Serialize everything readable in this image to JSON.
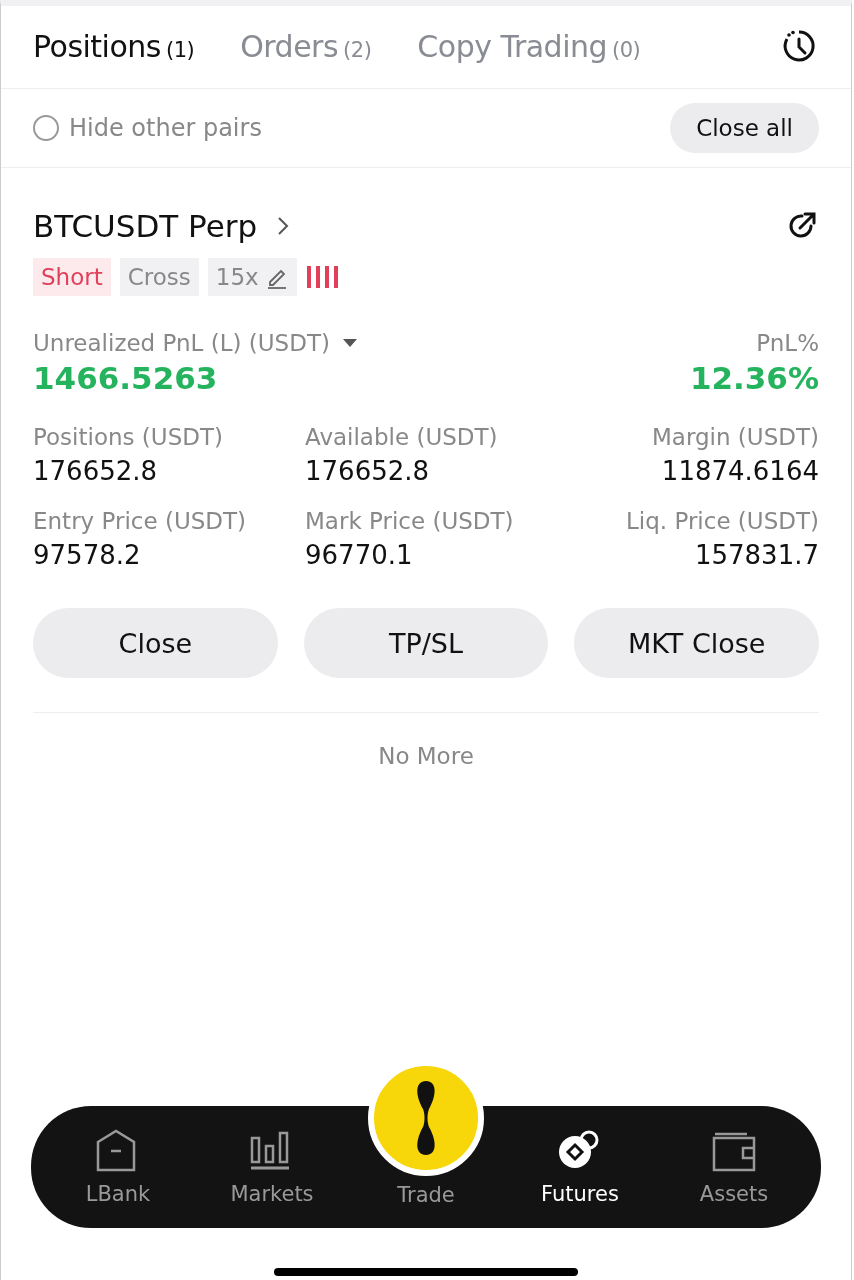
{
  "tabs": [
    {
      "label": "Positions",
      "count": "(1)",
      "selected": true
    },
    {
      "label": "Orders",
      "count": "(2)",
      "selected": false
    },
    {
      "label": "Copy Trading",
      "count": "(0)",
      "selected": false
    }
  ],
  "filter": {
    "label": "Hide other pairs",
    "checked": false
  },
  "close_all": "Close all",
  "position": {
    "symbol": "BTCUSDT Perp",
    "tags": [
      {
        "label": "Short",
        "kind": "side"
      },
      {
        "label": "Cross",
        "kind": "mode"
      },
      {
        "label": "15x",
        "kind": "leverage"
      }
    ],
    "pnl_label": "Unrealized PnL (L) (USDT)",
    "pnl_value": "1466.5263",
    "pnl_pct_label": "PnL%",
    "pnl_pct_value": "12.36%",
    "stats": [
      {
        "label": "Positions (USDT)",
        "value": "176652.8"
      },
      {
        "label": "Available (USDT)",
        "value": "176652.8"
      },
      {
        "label": "Margin (USDT)",
        "value": "11874.6164"
      },
      {
        "label": "Entry Price (USDT)",
        "value": "97578.2"
      },
      {
        "label": "Mark Price (USDT)",
        "value": "96770.1"
      },
      {
        "label": "Liq. Price (USDT)",
        "value": "157831.7"
      }
    ],
    "buttons": [
      "Close",
      "TP/SL",
      "MKT Close"
    ]
  },
  "footer": "No More",
  "nav": [
    {
      "label": "LBank",
      "kind": "home",
      "selected": false
    },
    {
      "label": "Markets",
      "kind": "markets",
      "selected": false
    },
    {
      "label": "Trade",
      "kind": "trade",
      "selected": false
    },
    {
      "label": "Futures",
      "kind": "futures",
      "selected": true
    },
    {
      "label": "Assets",
      "kind": "assets",
      "selected": false
    }
  ]
}
